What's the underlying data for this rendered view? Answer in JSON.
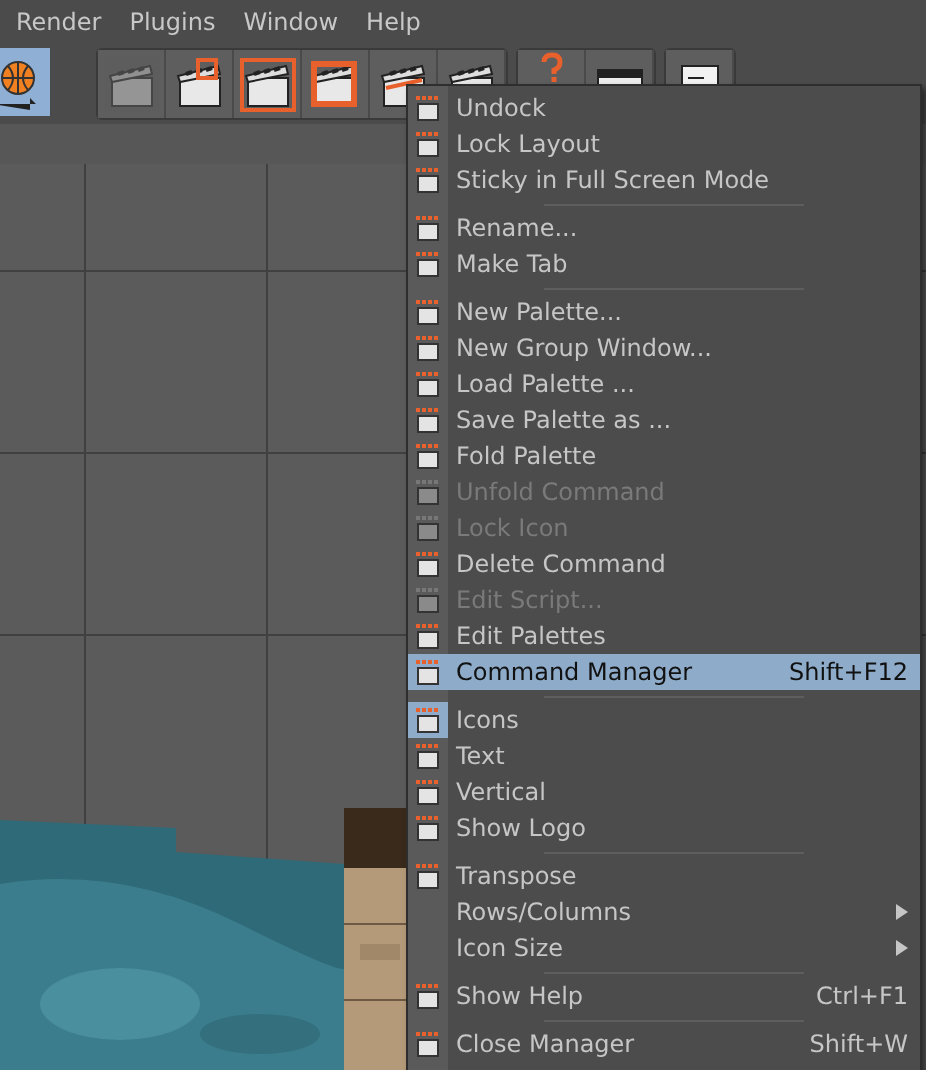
{
  "menubar": [
    "Render",
    "Plugins",
    "Window",
    "Help"
  ],
  "toolbar": {
    "groups": [
      {
        "buttons": [
          {
            "selected": true
          }
        ]
      },
      {
        "buttons": [
          {
            "selected": false
          },
          {
            "selected": false
          },
          {
            "selected": false
          },
          {
            "selected": false
          },
          {
            "selected": false
          },
          {
            "selected": false
          }
        ]
      },
      {
        "buttons": [
          {
            "selected": false
          },
          {
            "selected": false
          }
        ]
      },
      {
        "buttons": [
          {
            "selected": false
          }
        ]
      }
    ]
  },
  "context_menu": {
    "items": [
      {
        "kind": "command",
        "label": "Undock",
        "disabled": false,
        "selected": false
      },
      {
        "kind": "command",
        "label": "Lock Layout",
        "disabled": false,
        "selected": false
      },
      {
        "kind": "command",
        "label": "Sticky in Full Screen Mode",
        "disabled": false,
        "selected": false
      },
      {
        "kind": "separator"
      },
      {
        "kind": "command",
        "label": "Rename...",
        "disabled": false,
        "selected": false
      },
      {
        "kind": "command",
        "label": "Make Tab",
        "disabled": false,
        "selected": false
      },
      {
        "kind": "separator"
      },
      {
        "kind": "command",
        "label": "New Palette...",
        "disabled": false,
        "selected": false
      },
      {
        "kind": "command",
        "label": "New Group Window...",
        "disabled": false,
        "selected": false
      },
      {
        "kind": "command",
        "label": "Load Palette ...",
        "disabled": false,
        "selected": false
      },
      {
        "kind": "command",
        "label": "Save Palette as ...",
        "disabled": false,
        "selected": false
      },
      {
        "kind": "command",
        "label": "Fold Palette",
        "disabled": false,
        "selected": false
      },
      {
        "kind": "command",
        "label": "Unfold Command",
        "disabled": true,
        "selected": false
      },
      {
        "kind": "command",
        "label": "Lock Icon",
        "disabled": true,
        "selected": false
      },
      {
        "kind": "command",
        "label": "Delete Command",
        "disabled": false,
        "selected": false
      },
      {
        "kind": "command",
        "label": "Edit Script...",
        "disabled": true,
        "selected": false
      },
      {
        "kind": "command",
        "label": "Edit Palettes",
        "disabled": false,
        "selected": false
      },
      {
        "kind": "command",
        "label": "Command Manager",
        "shortcut": "Shift+F12",
        "disabled": false,
        "selected": true
      },
      {
        "kind": "separator"
      },
      {
        "kind": "command",
        "label": "Icons",
        "disabled": false,
        "selected": false,
        "checked": true
      },
      {
        "kind": "command",
        "label": "Text",
        "disabled": false,
        "selected": false,
        "checked": false
      },
      {
        "kind": "command",
        "label": "Vertical",
        "disabled": false,
        "selected": false,
        "checked": false
      },
      {
        "kind": "command",
        "label": "Show Logo",
        "disabled": false,
        "selected": false
      },
      {
        "kind": "separator"
      },
      {
        "kind": "command",
        "label": "Transpose",
        "disabled": false,
        "selected": false
      },
      {
        "kind": "submenu",
        "label": "Rows/Columns",
        "disabled": false,
        "selected": false
      },
      {
        "kind": "submenu",
        "label": "Icon Size",
        "disabled": false,
        "selected": false
      },
      {
        "kind": "separator"
      },
      {
        "kind": "command",
        "label": "Show Help",
        "shortcut": "Ctrl+F1",
        "disabled": false,
        "selected": false
      },
      {
        "kind": "separator"
      },
      {
        "kind": "command",
        "label": "Close Manager",
        "shortcut": "Shift+W",
        "disabled": false,
        "selected": false
      }
    ]
  }
}
